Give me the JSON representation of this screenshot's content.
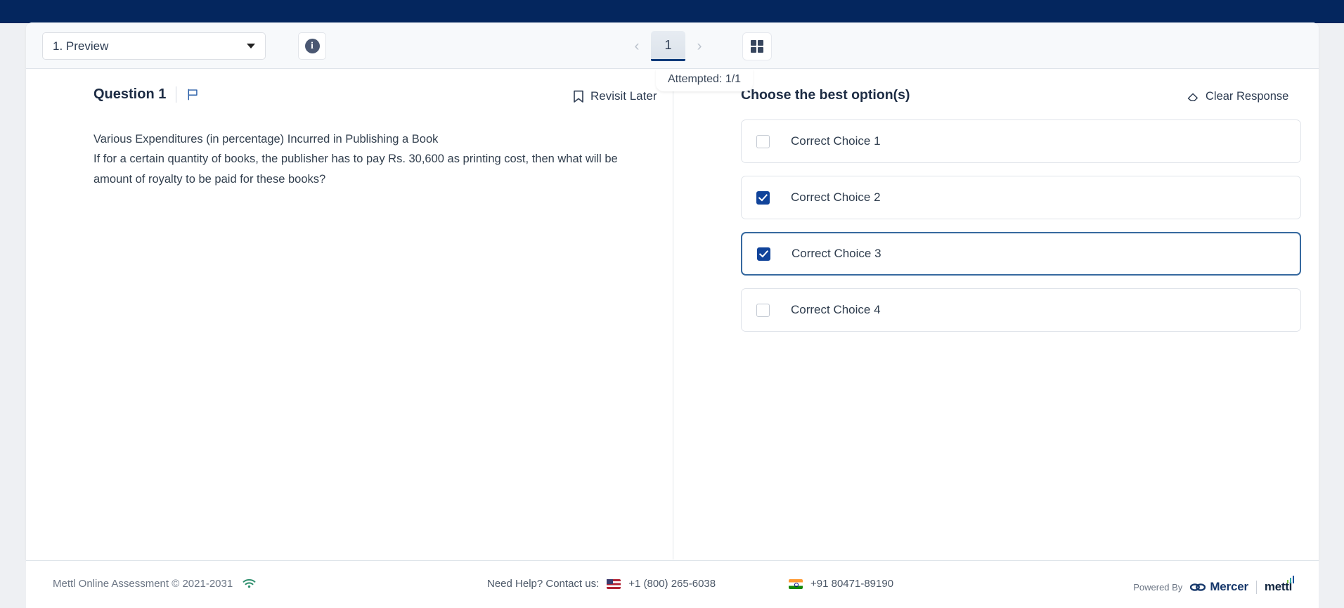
{
  "toolbar": {
    "section_select": {
      "value": "1. Preview",
      "caret_icon": "chevron-down-icon"
    },
    "info_icon": "info-icon",
    "prev_label": "‹",
    "next_label": "›",
    "current_page": "1",
    "grid_icon": "grid-view-icon",
    "tooltip": "Attempted: 1/1"
  },
  "question": {
    "title": "Question 1",
    "flag_icon": "flag-icon",
    "revisit_label": "Revisit Later",
    "revisit_icon": "bookmark-icon",
    "line1": "Various Expenditures (in percentage) Incurred in Publishing a Book",
    "line2": "If for a certain quantity of books, the publisher has to pay Rs. 30,600 as printing cost, then what will be amount of royalty to be paid for these books?"
  },
  "options_panel": {
    "heading": "Choose the best option(s)",
    "clear_label": "Clear Response",
    "clear_icon": "eraser-icon",
    "options": [
      {
        "label": "Correct Choice 1",
        "checked": false,
        "focused": false
      },
      {
        "label": "Correct Choice 2",
        "checked": true,
        "focused": false
      },
      {
        "label": "Correct Choice 3",
        "checked": true,
        "focused": true
      },
      {
        "label": "Correct Choice 4",
        "checked": false,
        "focused": false
      }
    ]
  },
  "footer": {
    "copyright": "Mettl Online Assessment © 2021-2031",
    "wifi_icon": "wifi-icon",
    "contact_label": "Need Help? Contact us:",
    "us_flag_icon": "us-flag-icon",
    "us_phone": "+1 (800) 265-6038",
    "in_flag_icon": "india-flag-icon",
    "in_phone": "+91 80471-89190",
    "powered_by": "Powered By",
    "brand_primary": "Mercer",
    "brand_secondary": "mettl"
  },
  "colors": {
    "topbar_navy": "#04265e",
    "accent_blue": "#10439a",
    "focus_blue": "#36699f",
    "wifi_green": "#2f8f6e"
  }
}
